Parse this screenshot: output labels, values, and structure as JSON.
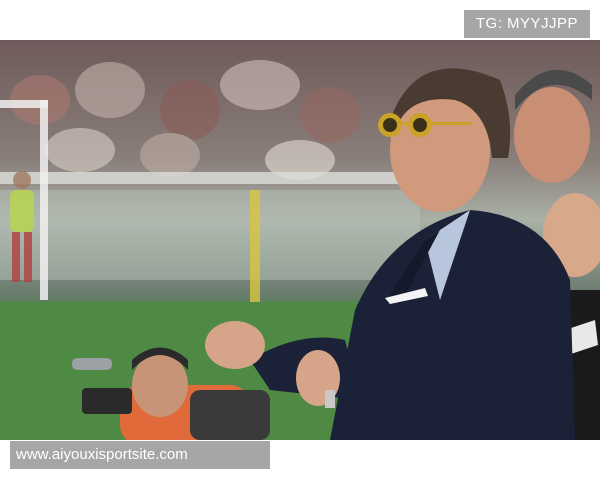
{
  "watermark_top": "TG: MYYJJPP",
  "watermark_bottom": "www.aiyouxisportsite.com",
  "colors": {
    "suit": "#1b2238",
    "pitch": "#4f8a44",
    "watermark_bg": "#a6a6a6",
    "sunglasses": "#c9a227"
  }
}
